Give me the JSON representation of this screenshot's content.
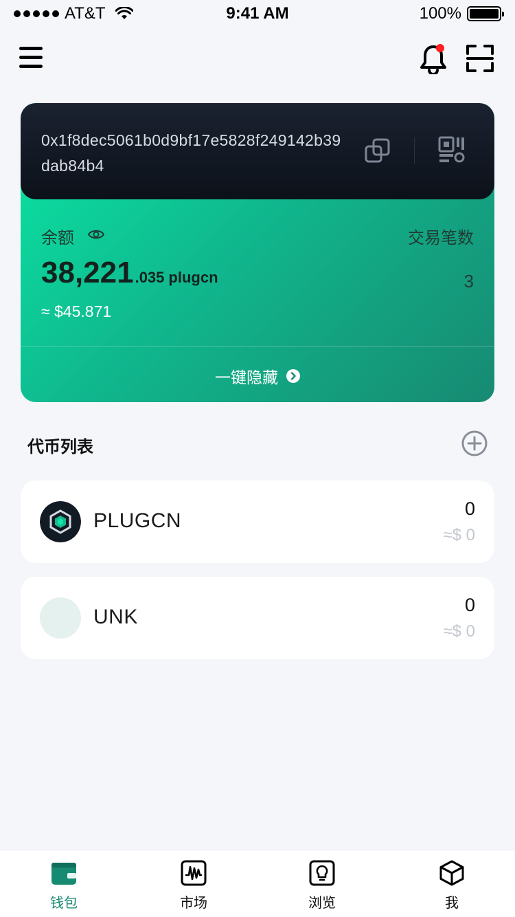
{
  "status_bar": {
    "carrier": "AT&T",
    "time": "9:41 AM",
    "battery": "100%"
  },
  "header": {
    "menu_icon": "menu-icon",
    "notification_icon": "bell-icon",
    "notification_badge": true,
    "scan_icon": "scan-icon"
  },
  "wallet": {
    "address": "0x1f8dec5061b0d9bf17e5828f249142b39dab84b4",
    "balance_label": "余额",
    "tx_label": "交易笔数",
    "balance_int": "38,221",
    "balance_dec": ".035",
    "balance_unit": "plugcn",
    "usd_value": "≈ $45.871",
    "tx_count": "3",
    "hide_label": "一键隐藏"
  },
  "token_list": {
    "title": "代币列表",
    "tokens": [
      {
        "name": "PLUGCN",
        "amount": "0",
        "usd": "≈$ 0",
        "icon": "plugcn-logo-icon"
      },
      {
        "name": "UNK",
        "amount": "0",
        "usd": "≈$ 0",
        "icon": "unknown-token-icon"
      }
    ]
  },
  "tabbar": {
    "tabs": [
      {
        "label": "钱包",
        "icon": "wallet-icon",
        "active": true
      },
      {
        "label": "市场",
        "icon": "market-icon",
        "active": false
      },
      {
        "label": "浏览",
        "icon": "browse-icon",
        "active": false
      },
      {
        "label": "我",
        "icon": "profile-cube-icon",
        "active": false
      }
    ]
  },
  "colors": {
    "accent": "#178a72",
    "card_gradient_start": "#0ae6a4",
    "card_gradient_end": "#178a72",
    "card_top_dark": "#0c1119",
    "badge_red": "#ff1f1f",
    "background": "#f4f6fa"
  }
}
